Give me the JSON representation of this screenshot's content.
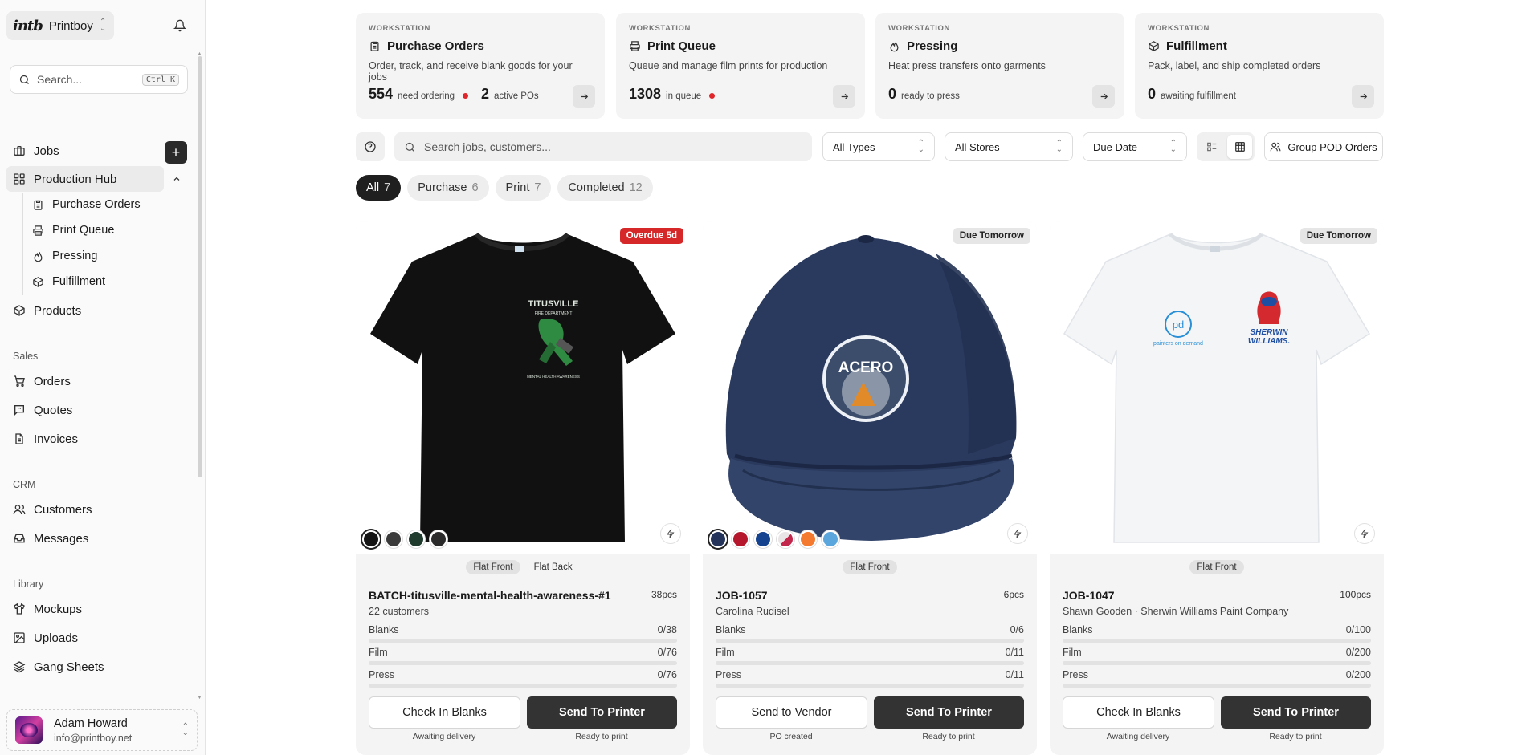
{
  "brand": {
    "logo": "intb",
    "name": "Printboy"
  },
  "search": {
    "placeholder": "Search...",
    "shortcut": "Ctrl K"
  },
  "nav": {
    "jobs": "Jobs",
    "production_hub": "Production Hub",
    "sub": [
      "Purchase Orders",
      "Print Queue",
      "Pressing",
      "Fulfillment"
    ],
    "products": "Products",
    "sales_label": "Sales",
    "sales": [
      "Orders",
      "Quotes",
      "Invoices"
    ],
    "crm_label": "CRM",
    "crm": [
      "Customers",
      "Messages"
    ],
    "library_label": "Library",
    "library": [
      "Mockups",
      "Uploads",
      "Gang Sheets"
    ]
  },
  "user": {
    "name": "Adam Howard",
    "email": "info@printboy.net"
  },
  "workstations": [
    {
      "kicker": "WORKSTATION",
      "title": "Purchase Orders",
      "icon": "clipboard-icon",
      "desc": "Order, track, and receive blank goods for your jobs",
      "n1": "554",
      "l1": "need ordering",
      "n2": "2",
      "l2": "active POs"
    },
    {
      "kicker": "WORKSTATION",
      "title": "Print Queue",
      "icon": "printer-icon",
      "desc": "Queue and manage film prints for production",
      "n1": "1308",
      "l1": "in queue"
    },
    {
      "kicker": "WORKSTATION",
      "title": "Pressing",
      "icon": "flame-icon",
      "desc": "Heat press transfers onto garments",
      "n1": "0",
      "l1": "ready to press"
    },
    {
      "kicker": "WORKSTATION",
      "title": "Fulfillment",
      "icon": "package-icon",
      "desc": "Pack, label, and ship completed orders",
      "n1": "0",
      "l1": "awaiting fulfillment"
    }
  ],
  "toolbar": {
    "search_placeholder": "Search jobs, customers...",
    "types": "All Types",
    "stores": "All Stores",
    "sort": "Due Date",
    "group_label": "Group POD Orders"
  },
  "tabs": [
    {
      "label": "All",
      "count": "7"
    },
    {
      "label": "Purchase",
      "count": "6"
    },
    {
      "label": "Print",
      "count": "7"
    },
    {
      "label": "Completed",
      "count": "12"
    }
  ],
  "jobs": [
    {
      "badge": "Overdue 5d",
      "views": [
        "Flat Front",
        "Flat Back"
      ],
      "title": "BATCH-titusville-mental-health-awareness-#1",
      "pcs": "38pcs",
      "sub": "22 customers",
      "progress": [
        {
          "label": "Blanks",
          "value": "0/38"
        },
        {
          "label": "Film",
          "value": "0/76"
        },
        {
          "label": "Press",
          "value": "0/76"
        }
      ],
      "btn1": "Check In Blanks",
      "btn2": "Send To Printer",
      "note1": "Awaiting delivery",
      "note2": "Ready to print",
      "swatches": [
        "#151515",
        "#3a3a3a",
        "#1f3b2e",
        "#2b2b2b"
      ],
      "print_text": [
        "TITUSVILLE",
        "FIRE DEPARTMENT",
        "MENTAL HEALTH AWARENESS"
      ]
    },
    {
      "badge": "Due Tomorrow",
      "views": [
        "Flat Front"
      ],
      "title": "JOB-1057",
      "pcs": "6pcs",
      "sub": "Carolina Rudisel",
      "progress": [
        {
          "label": "Blanks",
          "value": "0/6"
        },
        {
          "label": "Film",
          "value": "0/11"
        },
        {
          "label": "Press",
          "value": "0/11"
        }
      ],
      "btn1": "Send to Vendor",
      "btn2": "Send To Printer",
      "note1": "PO created",
      "note2": "Ready to print",
      "swatches": [
        "#24335a",
        "#b5162b",
        "#14428f",
        "#e9e4e6",
        "#f47a30",
        "#5aa6dd"
      ],
      "print_text": [
        "ACERO"
      ]
    },
    {
      "badge": "Due Tomorrow",
      "views": [
        "Flat Front"
      ],
      "title": "JOB-1047",
      "pcs": "100pcs",
      "sub": "Shawn Gooden · Sherwin Williams Paint Company",
      "progress": [
        {
          "label": "Blanks",
          "value": "0/100"
        },
        {
          "label": "Film",
          "value": "0/200"
        },
        {
          "label": "Press",
          "value": "0/200"
        }
      ],
      "btn1": "Check In Blanks",
      "btn2": "Send To Printer",
      "note1": "Awaiting delivery",
      "note2": "Ready to print",
      "swatches": [],
      "print_text": [
        "pd",
        "painters on demand",
        "SHERWIN",
        "WILLIAMS."
      ]
    }
  ]
}
